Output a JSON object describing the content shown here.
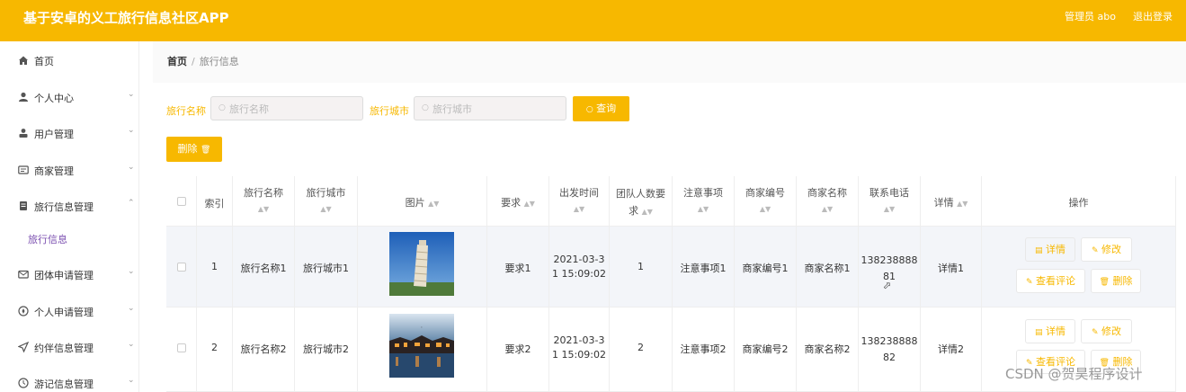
{
  "header": {
    "app_title": "基于安卓的义工旅行信息社区APP",
    "user_label": "管理员 abo",
    "logout_label": "退出登录"
  },
  "sidebar": {
    "items": [
      {
        "label": "首页",
        "icon": "home-icon",
        "has_arrow": false
      },
      {
        "label": "个人中心",
        "icon": "person-icon",
        "has_arrow": true
      },
      {
        "label": "用户管理",
        "icon": "user-icon",
        "has_arrow": true
      },
      {
        "label": "商家管理",
        "icon": "id-card-icon",
        "has_arrow": true
      },
      {
        "label": "旅行信息管理",
        "icon": "document-icon",
        "has_arrow": true,
        "expanded": true
      },
      {
        "label": "团体申请管理",
        "icon": "mail-icon",
        "has_arrow": true
      },
      {
        "label": "个人申请管理",
        "icon": "compass-icon",
        "has_arrow": true
      },
      {
        "label": "约伴信息管理",
        "icon": "send-icon",
        "has_arrow": true
      },
      {
        "label": "游记信息管理",
        "icon": "clock-icon",
        "has_arrow": true
      }
    ],
    "sub_item": "旅行信息"
  },
  "breadcrumb": {
    "home": "首页",
    "separator": "/",
    "current": "旅行信息"
  },
  "search": {
    "name_label": "旅行名称",
    "name_placeholder": "旅行名称",
    "city_label": "旅行城市",
    "city_placeholder": "旅行城市",
    "query_button": "查询"
  },
  "actions": {
    "delete_button": "删除"
  },
  "table": {
    "columns": [
      "索引",
      "旅行名称",
      "旅行城市",
      "图片",
      "要求",
      "出发时间",
      "团队人数要求",
      "注意事项",
      "商家编号",
      "商家名称",
      "联系电话",
      "详情",
      "操作"
    ],
    "rows": [
      {
        "index": "1",
        "name": "旅行名称1",
        "city": "旅行城市1",
        "image": "leaning-tower-photo",
        "requirement": "要求1",
        "depart_line1": "2021-03-3",
        "depart_line2": "1 15:09:02",
        "team_size": "1",
        "notes": "注意事项1",
        "merchant_no": "商家编号1",
        "merchant_name": "商家名称1",
        "phone_line1": "138238888",
        "phone_line2": "81",
        "detail": "详情1"
      },
      {
        "index": "2",
        "name": "旅行名称2",
        "city": "旅行城市2",
        "image": "night-waterfront-photo",
        "requirement": "要求2",
        "depart_line1": "2021-03-3",
        "depart_line2": "1 15:09:02",
        "team_size": "2",
        "notes": "注意事项2",
        "merchant_no": "商家编号2",
        "merchant_name": "商家名称2",
        "phone_line1": "138238888",
        "phone_line2": "82",
        "detail": "详情2"
      }
    ],
    "row_actions": {
      "detail": "详情",
      "edit": "修改",
      "comments": "查看评论",
      "delete": "删除"
    }
  },
  "watermark": "CSDN @贺昊程序设计",
  "colors": {
    "accent": "#f7b800",
    "submenu_active": "#7b4fb0"
  }
}
